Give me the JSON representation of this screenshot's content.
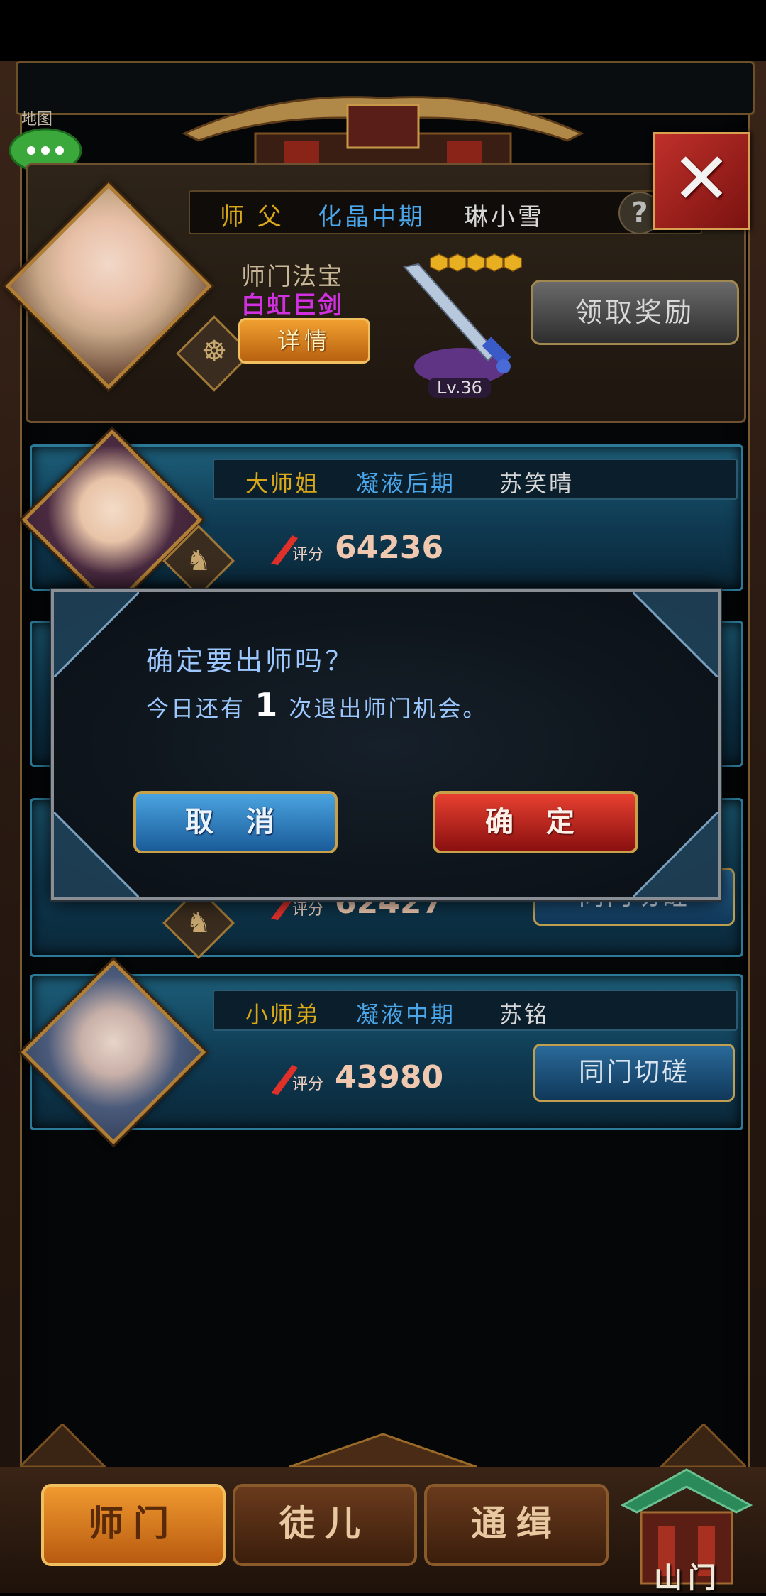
{
  "top_left": {
    "label": "地图"
  },
  "master": {
    "role": "师 父",
    "realm": "化晶中期",
    "name": "琳小雪",
    "treasure_label": "师门法宝",
    "treasure_name": "白虹巨剑",
    "detail_button": "详情",
    "weapon_level": "Lv.36",
    "reward_button": "领取奖励",
    "help_icon": "?"
  },
  "disciples": [
    {
      "role": "大师姐",
      "realm": "凝液后期",
      "name": "苏笑晴",
      "score_label": "评分",
      "score": "64236"
    },
    {
      "score_label": "评分",
      "score": "62427",
      "spar_button": "同门切磋"
    },
    {
      "role": "小师弟",
      "realm": "凝液中期",
      "name": "苏铭",
      "score_label": "评分",
      "score": "43980",
      "spar_button": "同门切磋"
    }
  ],
  "dialog": {
    "title": "确定要出师吗？",
    "sub_prefix": "今日还有",
    "sub_count": "1",
    "sub_suffix": "次退出师门机会。",
    "cancel": "取 消",
    "confirm": "确 定"
  },
  "tabs": [
    {
      "label": "师门",
      "active": true
    },
    {
      "label": "徒儿",
      "active": false
    },
    {
      "label": "通缉",
      "active": false
    }
  ],
  "gate": {
    "label": "山门"
  },
  "colors": {
    "role_gold": "#d8a818",
    "realm_blue": "#4aa6e8",
    "name_light": "#d8d8d8",
    "treasure_purple": "#d030e0",
    "dialog_text": "#9cc8ff"
  },
  "icons": [
    "chat-bubble-icon",
    "close-icon",
    "help-icon",
    "sword-icon",
    "star-icon",
    "score-blade-icon",
    "monk-badge-icon",
    "lion-badge-icon",
    "gate-icon"
  ]
}
